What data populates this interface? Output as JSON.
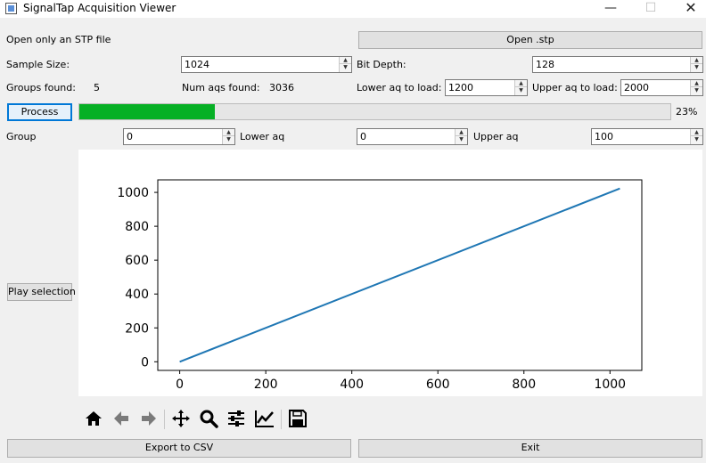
{
  "window": {
    "title": "SignalTap Acquisition Viewer"
  },
  "controls": {
    "open_label": "Open only an STP file",
    "open_button": "Open .stp",
    "sample_size_label": "Sample Size:",
    "sample_size_value": "1024",
    "bit_depth_label": "Bit Depth:",
    "bit_depth_value": "128",
    "groups_found_label": "Groups found:",
    "groups_found_value": "5",
    "num_aqs_label": "Num aqs found:",
    "num_aqs_value": "3036",
    "lower_aq_load_label": "Lower aq to load:",
    "lower_aq_load_value": "1200",
    "upper_aq_load_label": "Upper aq to load:",
    "upper_aq_load_value": "2000",
    "process_button": "Process",
    "progress_percent": 23,
    "progress_text": "23%",
    "group_label": "Group",
    "group_value": "0",
    "lower_aq_label": "Lower aq",
    "lower_aq_value": "0",
    "upper_aq_label": "Upper aq",
    "upper_aq_value": "100",
    "play_selection_button": "Play selection",
    "export_button": "Export to CSV",
    "exit_button": "Exit"
  },
  "toolbar": {
    "icons": [
      "home-icon",
      "back-arrow-icon",
      "forward-arrow-icon",
      "pan-icon",
      "zoom-icon",
      "configure-subplots-icon",
      "edit-axis-icon",
      "save-icon"
    ]
  },
  "colors": {
    "line": "#1f77b4",
    "progress": "#06b025",
    "focus": "#0078d7"
  },
  "chart_data": {
    "type": "line",
    "title": "",
    "xlabel": "",
    "ylabel": "",
    "x": [
      0,
      1023
    ],
    "series": [
      {
        "values": [
          0,
          1023
        ]
      }
    ],
    "xlim": [
      -51,
      1074
    ],
    "ylim": [
      -51,
      1074
    ],
    "xticks": [
      0,
      200,
      400,
      600,
      800,
      1000
    ],
    "yticks": [
      0,
      200,
      400,
      600,
      800,
      1000
    ],
    "grid": false
  }
}
